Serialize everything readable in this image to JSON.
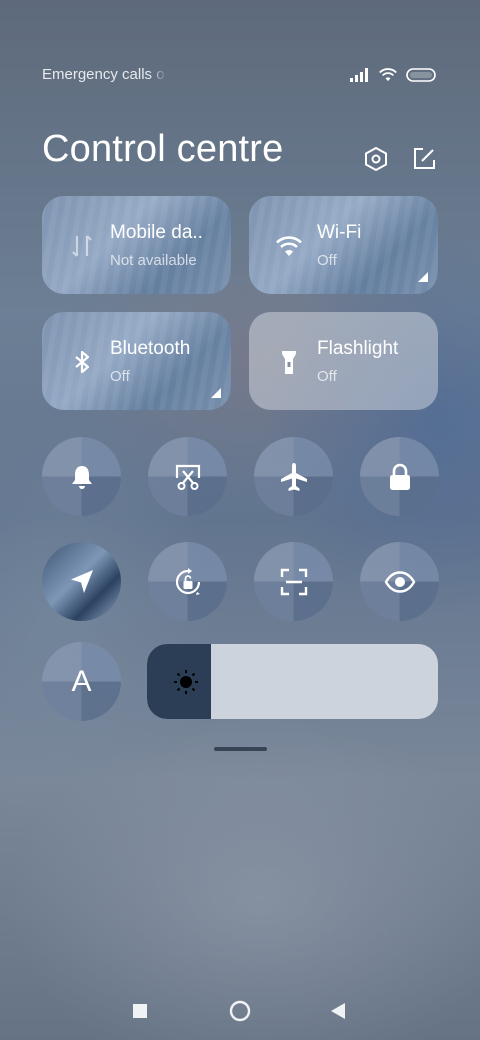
{
  "status": {
    "carrier_text": "Emergency calls o",
    "icons": [
      "signal-icon",
      "wifi-icon",
      "battery-icon"
    ]
  },
  "header": {
    "title": "Control centre",
    "settings_icon": "hexagon-settings-icon",
    "edit_icon": "edit-icon"
  },
  "tiles": [
    {
      "id": "mobile-data",
      "label": "Mobile da..",
      "status": "Not available",
      "icon": "mobile-data-icon",
      "active": false
    },
    {
      "id": "wifi",
      "label": "Wi-Fi",
      "status": "Off",
      "icon": "wifi-icon",
      "active": false
    },
    {
      "id": "bluetooth",
      "label": "Bluetooth",
      "status": "Off",
      "icon": "bluetooth-icon",
      "active": false
    },
    {
      "id": "flashlight",
      "label": "Flashlight",
      "status": "Off",
      "icon": "flashlight-icon",
      "active": true
    }
  ],
  "toggles": [
    {
      "id": "sound",
      "icon": "bell-icon",
      "active": false
    },
    {
      "id": "screenshot",
      "icon": "scissors-screenshot-icon",
      "active": false
    },
    {
      "id": "airplane",
      "icon": "airplane-icon",
      "active": false
    },
    {
      "id": "lock-screen",
      "icon": "lock-icon",
      "active": false
    },
    {
      "id": "location",
      "icon": "location-arrow-icon",
      "active": true
    },
    {
      "id": "rotation",
      "icon": "rotation-lock-icon",
      "active": false
    },
    {
      "id": "scanner",
      "icon": "scan-icon",
      "active": false
    },
    {
      "id": "reading-mode",
      "icon": "eye-icon",
      "active": false
    },
    {
      "id": "auto-brightness",
      "icon": "font-a-icon",
      "label": "A",
      "active": false
    }
  ],
  "brightness": {
    "level": 0.22,
    "icon": "sun-icon"
  },
  "navigation": {
    "buttons": [
      "recents-square-icon",
      "home-circle-icon",
      "back-triangle-icon"
    ]
  },
  "colors": {
    "active_tile": "#e1e4eb",
    "brightness_fill": "#2c3e55",
    "brightness_track": "#ccd3dd"
  }
}
